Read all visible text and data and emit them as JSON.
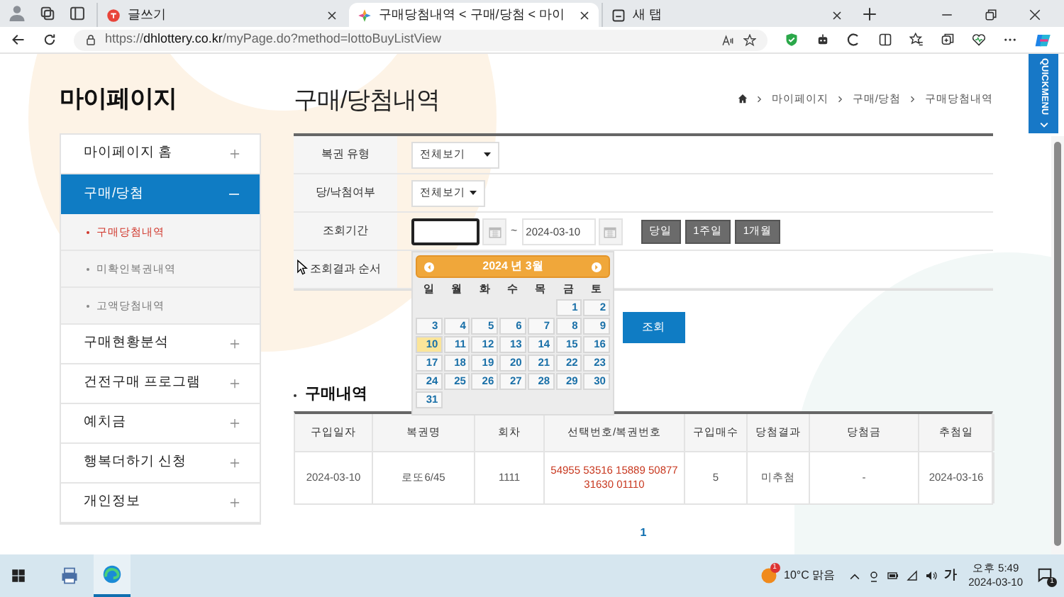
{
  "browser": {
    "tabs": [
      {
        "title": "글쓰기",
        "selected": false
      },
      {
        "title": "구매당첨내역 < 구매/당첨 < 마이",
        "selected": true
      },
      {
        "title": "새 탭",
        "selected": false
      }
    ],
    "url_scheme": "https://",
    "url_host": "dhlottery.co.kr",
    "url_path": "/myPage.do?method=lottoBuyListView"
  },
  "sidebar": {
    "title": "마이페이지",
    "menu": [
      {
        "label": "마이페이지 홈",
        "expanded": false
      },
      {
        "label": "구매/당첨",
        "expanded": true,
        "children": [
          {
            "label": "구매당첨내역",
            "selected": true
          },
          {
            "label": "미확인복권내역",
            "selected": false
          },
          {
            "label": "고액당첨내역",
            "selected": false
          }
        ]
      },
      {
        "label": "구매현황분석",
        "expanded": false
      },
      {
        "label": "건전구매 프로그램",
        "expanded": false
      },
      {
        "label": "예치금",
        "expanded": false
      },
      {
        "label": "행복더하기 신청",
        "expanded": false
      },
      {
        "label": "개인정보",
        "expanded": false
      }
    ]
  },
  "page": {
    "title": "구매/당첨내역",
    "breadcrumb": [
      "마이페이지",
      "구매/당첨",
      "구매당첨내역"
    ]
  },
  "filters": [
    {
      "kind": "select",
      "label": "복권 유형",
      "value": "전체보기"
    },
    {
      "kind": "select",
      "label": "당/낙첨여부",
      "value": "전체보기"
    },
    {
      "kind": "period",
      "label": "조회기간",
      "separator": "~",
      "end": "2024-03-10",
      "presets": [
        "당일",
        "1주일",
        "1개월"
      ]
    },
    {
      "kind": "blank",
      "label": "조회결과 순서"
    }
  ],
  "search_button": "조회",
  "calendar": {
    "title": "2024 년 3월",
    "weekdays": [
      "일",
      "월",
      "화",
      "수",
      "목",
      "금",
      "토"
    ],
    "weeks": [
      {
        "kind": "leading",
        "days": [
          {
            "label": "1",
            "selected": false
          },
          {
            "label": "2",
            "selected": false
          }
        ]
      },
      {
        "kind": "full",
        "days": [
          {
            "label": "3",
            "selected": false
          },
          {
            "label": "4",
            "selected": false
          },
          {
            "label": "5",
            "selected": false
          },
          {
            "label": "6",
            "selected": false
          },
          {
            "label": "7",
            "selected": false
          },
          {
            "label": "8",
            "selected": false
          },
          {
            "label": "9",
            "selected": false
          }
        ]
      },
      {
        "kind": "full",
        "days": [
          {
            "label": "10",
            "selected": true
          },
          {
            "label": "11",
            "selected": false
          },
          {
            "label": "12",
            "selected": false
          },
          {
            "label": "13",
            "selected": false
          },
          {
            "label": "14",
            "selected": false
          },
          {
            "label": "15",
            "selected": false
          },
          {
            "label": "16",
            "selected": false
          }
        ]
      },
      {
        "kind": "full",
        "days": [
          {
            "label": "17",
            "selected": false
          },
          {
            "label": "18",
            "selected": false
          },
          {
            "label": "19",
            "selected": false
          },
          {
            "label": "20",
            "selected": false
          },
          {
            "label": "21",
            "selected": false
          },
          {
            "label": "22",
            "selected": false
          },
          {
            "label": "23",
            "selected": false
          }
        ]
      },
      {
        "kind": "full",
        "days": [
          {
            "label": "24",
            "selected": false
          },
          {
            "label": "25",
            "selected": false
          },
          {
            "label": "26",
            "selected": false
          },
          {
            "label": "27",
            "selected": false
          },
          {
            "label": "28",
            "selected": false
          },
          {
            "label": "29",
            "selected": false
          },
          {
            "label": "30",
            "selected": false
          }
        ]
      },
      {
        "kind": "trailing",
        "days": [
          {
            "label": "31",
            "selected": false
          }
        ]
      }
    ]
  },
  "purchases": {
    "title": "구매내역",
    "columns": [
      {
        "label": "구입일자",
        "kind": "text"
      },
      {
        "label": "복권명",
        "kind": "text"
      },
      {
        "label": "회차",
        "kind": "text"
      },
      {
        "label": "선택번호/복권번호",
        "kind": "numbers"
      },
      {
        "label": "구입매수",
        "kind": "text"
      },
      {
        "label": "당첨결과",
        "kind": "text"
      },
      {
        "label": "당첨금",
        "kind": "text"
      },
      {
        "label": "추첨일",
        "kind": "text"
      }
    ],
    "rows": [
      [
        "2024-03-10",
        "로또6/45",
        "1111",
        "54955 53516 15889 50877 31630 01110",
        "5",
        "미추첨",
        "-",
        "2024-03-16"
      ]
    ]
  },
  "pagination": [
    {
      "label": "1",
      "selected": true
    }
  ],
  "quick_menu": "QUICKMENU",
  "taskbar": {
    "weather_badge": "1",
    "weather": "10°C 맑음",
    "ime": "가",
    "time": "오후 5:49",
    "date": "2024-03-10",
    "notifications": "1"
  }
}
